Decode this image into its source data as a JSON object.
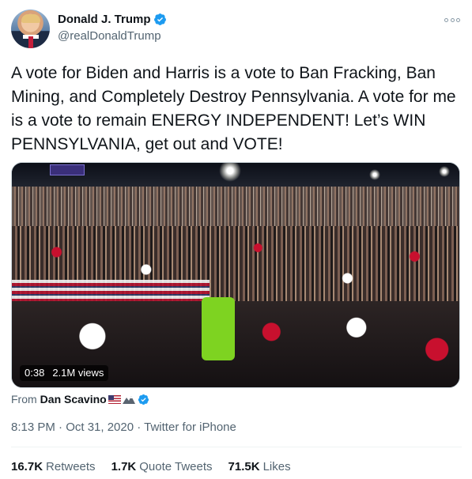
{
  "author": {
    "display_name": "Donald J. Trump",
    "handle": "@realDonaldTrump",
    "avatar_icon": "profile-avatar",
    "verified_icon": "verified-badge-icon"
  },
  "tweet": {
    "text": "A vote for Biden and Harris is a vote to Ban Fracking, Ban Mining, and Completely Destroy Pennsylvania. A vote for me is a vote to remain ENERGY INDEPENDENT! Let’s WIN PENNSYLVANIA, get out and VOTE!"
  },
  "media": {
    "duration": "0:38",
    "views": "2.1M views"
  },
  "source": {
    "prefix": "From",
    "name": "Dan Scavino"
  },
  "meta": {
    "timestamp": "8:13 PM · Oct 31, 2020 · Twitter for iPhone"
  },
  "stats": {
    "retweets_count": "16.7K",
    "retweets_label": "Retweets",
    "quotes_count": "1.7K",
    "quotes_label": "Quote Tweets",
    "likes_count": "71.5K",
    "likes_label": "Likes"
  },
  "colors": {
    "verified": "#1d9bf0",
    "secondary_text": "#536471",
    "primary_text": "#0f1419"
  }
}
